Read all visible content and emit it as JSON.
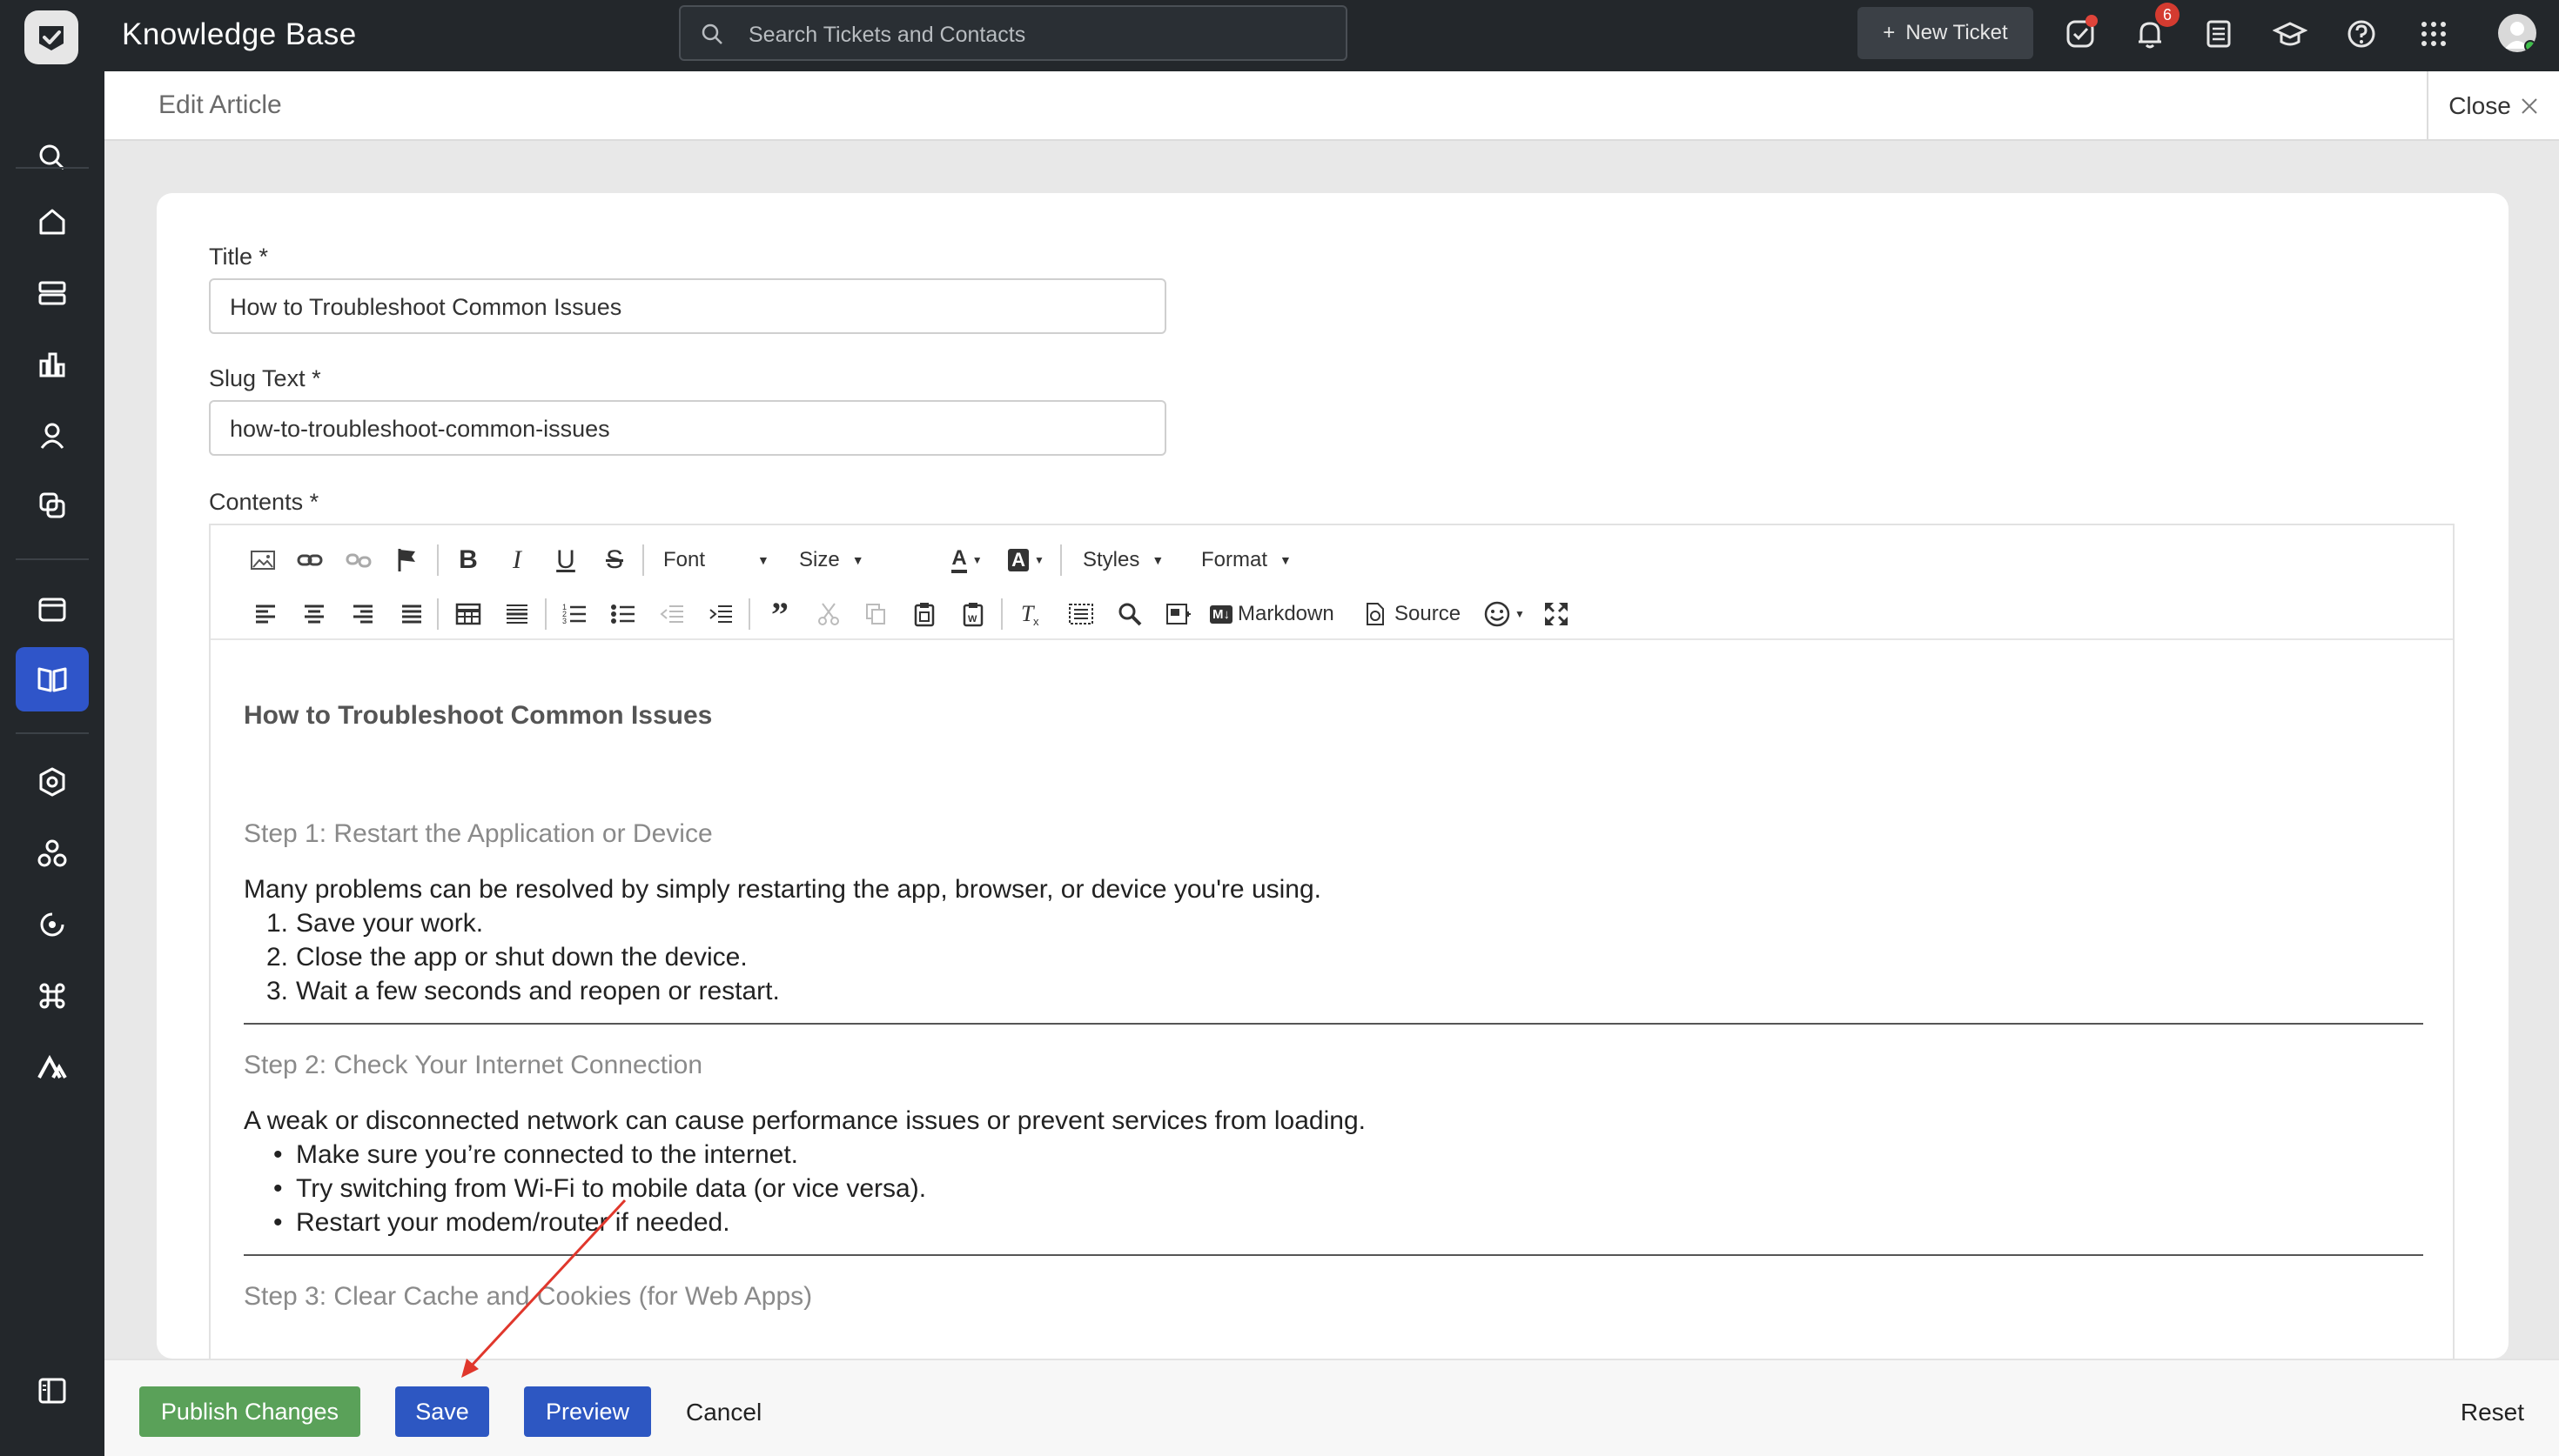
{
  "app": {
    "title": "Knowledge Base",
    "search_placeholder": "Search Tickets and Contacts",
    "new_ticket_label": "New Ticket",
    "notification_count": "6",
    "accent_color": "#2d57c2"
  },
  "header": {
    "page_title": "Edit Article",
    "close_label": "Close"
  },
  "form": {
    "title_label": "Title *",
    "title_value": "How to Troubleshoot Common Issues",
    "slug_label": "Slug Text *",
    "slug_value": "how-to-troubleshoot-common-issues",
    "contents_label": "Contents *"
  },
  "toolbar": {
    "font_label": "Font",
    "size_label": "Size",
    "styles_label": "Styles",
    "format_label": "Format",
    "markdown_label": "Markdown",
    "source_label": "Source"
  },
  "document": {
    "heading": "How to Troubleshoot Common Issues",
    "steps": [
      {
        "title": "Step 1: Restart the Application or Device",
        "intro": "Many problems can be resolved by simply restarting the app, browser, or device you're using.",
        "items": [
          "Save your work.",
          "Close the app or shut down the device.",
          "Wait a few seconds and reopen or restart."
        ]
      },
      {
        "title": "Step 2: Check Your Internet Connection",
        "intro": "A weak or disconnected network can cause performance issues or prevent services from loading.",
        "items": [
          "Make sure you’re connected to the internet.",
          "Try switching from Wi-Fi to mobile data (or vice versa).",
          "Restart your modem/router if needed."
        ]
      },
      {
        "title": "Step 3: Clear Cache and Cookies (for Web Apps)"
      }
    ],
    "ordered_markers": [
      "1.",
      "2.",
      "3."
    ],
    "bullet_marker": "•"
  },
  "footer": {
    "publish_label": "Publish Changes",
    "save_label": "Save",
    "preview_label": "Preview",
    "cancel_label": "Cancel",
    "reset_label": "Reset"
  }
}
